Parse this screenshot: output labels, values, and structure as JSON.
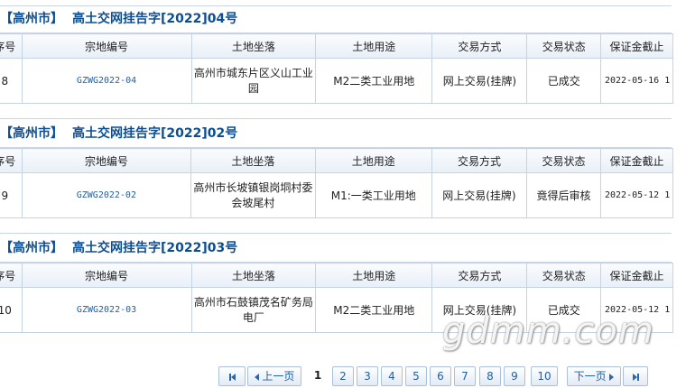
{
  "columns": [
    "序号",
    "宗地编号",
    "土地坐落",
    "土地用途",
    "交易方式",
    "交易状态",
    "保证金截止"
  ],
  "sections": [
    {
      "city": "【高州市】",
      "notice": "高土交网挂告字[2022]04号",
      "row": {
        "seq": "8",
        "code": "GZWG2022-04",
        "location": "高州市城东片区义山工业园",
        "use": "M2二类工业用地",
        "method": "网上交易(挂牌)",
        "status": "已成交",
        "deadline": "2022-05-16 1"
      }
    },
    {
      "city": "【高州市】",
      "notice": "高土交网挂告字[2022]02号",
      "row": {
        "seq": "9",
        "code": "GZWG2022-02",
        "location": "高州市长坡镇银岗垌村委会坡尾村",
        "use": "M1:一类工业用地",
        "method": "网上交易(挂牌)",
        "status": "竟得后审核",
        "deadline": "2022-05-12 1"
      }
    },
    {
      "city": "【高州市】",
      "notice": "高土交网挂告字[2022]03号",
      "row": {
        "seq": "10",
        "code": "GZWG2022-03",
        "location": "高州市石鼓镇茂名矿务局电厂",
        "use": "M2二类工业用地",
        "method": "网上交易(挂牌)",
        "status": "已成交",
        "deadline": "2022-05-12 1"
      }
    }
  ],
  "pagination": {
    "first_icon": "first-page-icon",
    "prev_label": "上一页",
    "pages": [
      "1",
      "2",
      "3",
      "4",
      "5",
      "6",
      "7",
      "8",
      "9",
      "10"
    ],
    "current_page": "1",
    "next_label": "下一页",
    "last_icon": "last-page-icon"
  },
  "watermark": "gdmm.com"
}
